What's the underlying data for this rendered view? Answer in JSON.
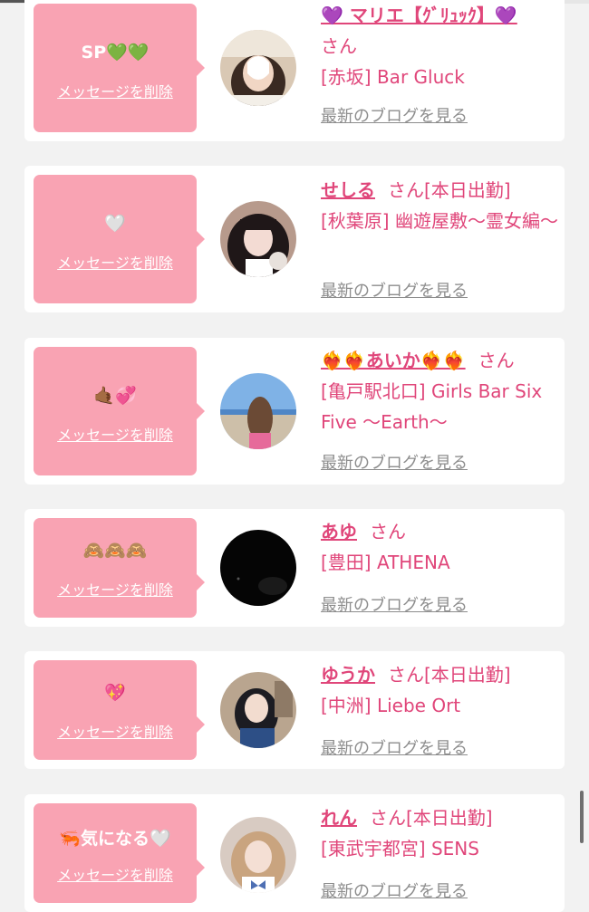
{
  "common": {
    "delete_label": "メッセージを削除",
    "blog_label": "最新のブログを見る",
    "san": "さん"
  },
  "colors": {
    "bubble": "#f9a3b3",
    "accent": "#e0467a",
    "muted": "#8d8d8d",
    "background": "#f2f2f2"
  },
  "items": [
    {
      "message": "SP💚💚",
      "name": "💜 マリエ【ｸﾞﾘｭｯｸ】💜",
      "status": "",
      "shop": "[赤坂] Bar Gluck",
      "avatar_icon": "girl-heart-sticker-photo"
    },
    {
      "message": "🤍",
      "name": "せしる",
      "status": "[本日出勤]",
      "shop": "[秋葉原] 幽遊屋敷～霊女編～",
      "avatar_icon": "girl-costume-photo"
    },
    {
      "message": "🤙🏾💞",
      "name": "❤️‍🔥❤️‍🔥あいか❤️‍🔥❤️‍🔥",
      "status": "",
      "shop": "[亀戸駅北口] Girls Bar Six Five ～Earth～",
      "avatar_icon": "beach-photo"
    },
    {
      "message": "🙈🙈🙈",
      "name": "あゆ",
      "status": "",
      "shop": "[豊田] ATHENA",
      "avatar_icon": "dark-photo"
    },
    {
      "message": "💖",
      "name": "ゆうか",
      "status": "[本日出勤]",
      "shop": "[中洲] Liebe Ort",
      "avatar_icon": "girl-uniform-photo"
    },
    {
      "message": "🦐気になる🤍",
      "name": "れん",
      "status": "[本日出勤]",
      "shop": "[東武宇都宮] SENS",
      "avatar_icon": "girl-bow-photo"
    }
  ]
}
